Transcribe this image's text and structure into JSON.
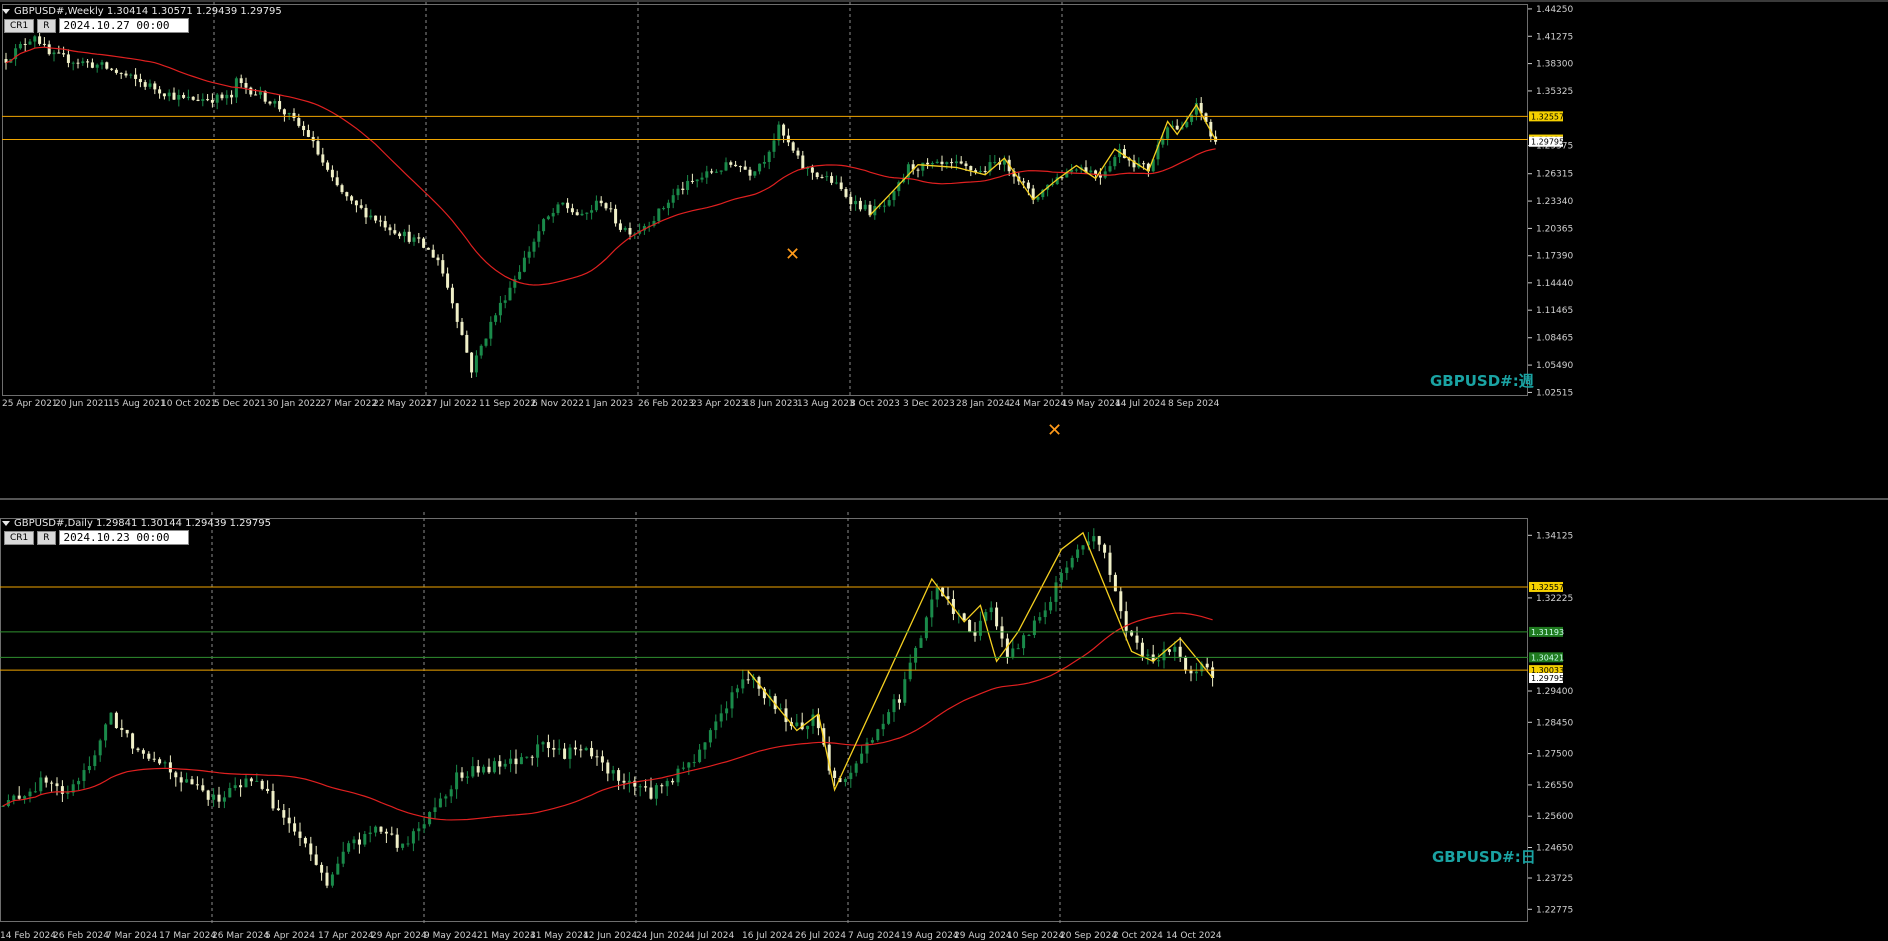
{
  "colors": {
    "background": "#000000",
    "bull": "#1a8a4a",
    "bear": "#f0f0c8",
    "ma": "#e02020",
    "zigzag": "#f5d020",
    "hline_gold": "#f0a500",
    "hline_green": "#2f8f2f",
    "label_teal": "#1aa3a3",
    "grid": "#8c8c8c",
    "axis_text": "#d0d0d0"
  },
  "weekly": {
    "header": "GBPUSD#,Weekly  1.30414 1.30571 1.29439 1.29795",
    "buttons": [
      "CR1",
      "R"
    ],
    "date_value": "2024.10.27 00:00",
    "symbol_label": "GBPUSD#:週",
    "cursor_icon": "crosshair-move-icon",
    "chart_data": {
      "type": "candlestick",
      "ylim": [
        1.0256,
        1.4435
      ],
      "price_ticks": [
        "1.44250",
        "1.41275",
        "1.38300",
        "1.35325",
        "1.29375",
        "1.26315",
        "1.23340",
        "1.20365",
        "1.17390",
        "1.14440",
        "1.11465",
        "1.08465",
        "1.05490",
        "1.02515"
      ],
      "time_ticks": [
        "25 Apr 2021",
        "20 Jun 2021",
        "15 Aug 2021",
        "10 Oct 2021",
        "5 Dec 2021",
        "30 Jan 2022",
        "27 Mar 2022",
        "22 May 2022",
        "17 Jul 2022",
        "11 Sep 2022",
        "6 Nov 2022",
        "1 Jan 2023",
        "26 Feb 2023",
        "23 Apr 2023",
        "18 Jun 2023",
        "13 Aug 2023",
        "8 Oct 2023",
        "3 Dec 2023",
        "28 Jan 2024",
        "24 Mar 2024",
        "19 May 2024",
        "14 Jul 2024",
        "8 Sep 2024"
      ],
      "hlines": [
        {
          "value": 1.32557,
          "label": "1.32557",
          "color": "gold"
        },
        {
          "value": 1.30033,
          "label": "1.30033",
          "color": "gold"
        }
      ],
      "close_label": "1.29795",
      "anchors": [
        [
          0,
          1.388
        ],
        [
          6,
          1.415
        ],
        [
          9,
          1.392
        ],
        [
          20,
          1.38
        ],
        [
          33,
          1.352
        ],
        [
          37,
          1.344
        ],
        [
          47,
          1.346
        ],
        [
          48,
          1.363
        ],
        [
          56,
          1.34
        ],
        [
          63,
          1.305
        ],
        [
          68,
          1.255
        ],
        [
          72,
          1.23
        ],
        [
          80,
          1.205
        ],
        [
          86,
          1.188
        ],
        [
          90,
          1.17
        ],
        [
          93,
          1.125
        ],
        [
          97,
          1.05
        ],
        [
          101,
          1.1
        ],
        [
          107,
          1.16
        ],
        [
          112,
          1.21
        ],
        [
          116,
          1.23
        ],
        [
          120,
          1.215
        ],
        [
          124,
          1.235
        ],
        [
          128,
          1.205
        ],
        [
          131,
          1.2
        ],
        [
          135,
          1.215
        ],
        [
          140,
          1.245
        ],
        [
          147,
          1.265
        ],
        [
          152,
          1.275
        ],
        [
          155,
          1.265
        ],
        [
          158,
          1.28
        ],
        [
          161,
          1.312
        ],
        [
          166,
          1.27
        ],
        [
          172,
          1.255
        ],
        [
          176,
          1.235
        ],
        [
          180,
          1.222
        ],
        [
          184,
          1.23
        ],
        [
          188,
          1.27
        ],
        [
          192,
          1.271
        ],
        [
          198,
          1.272
        ],
        [
          203,
          1.265
        ],
        [
          207,
          1.278
        ],
        [
          210,
          1.265
        ],
        [
          214,
          1.236
        ],
        [
          218,
          1.255
        ],
        [
          223,
          1.272
        ],
        [
          228,
          1.262
        ],
        [
          232,
          1.288
        ],
        [
          235,
          1.275
        ],
        [
          238,
          1.268
        ],
        [
          242,
          1.318
        ],
        [
          245,
          1.31
        ],
        [
          248,
          1.336
        ],
        [
          250,
          1.32
        ],
        [
          251,
          1.304
        ],
        [
          252,
          1.298
        ]
      ],
      "ma_period": 30,
      "zigzag": [
        [
          180,
          1.218
        ],
        [
          190,
          1.273
        ],
        [
          198,
          1.27
        ],
        [
          204,
          1.262
        ],
        [
          208,
          1.28
        ],
        [
          214,
          1.235
        ],
        [
          219,
          1.257
        ],
        [
          223,
          1.272
        ],
        [
          227,
          1.258
        ],
        [
          231,
          1.29
        ],
        [
          235,
          1.276
        ],
        [
          238,
          1.266
        ],
        [
          242,
          1.32
        ],
        [
          244,
          1.306
        ],
        [
          248,
          1.338
        ],
        [
          252,
          1.3
        ]
      ]
    }
  },
  "daily": {
    "header": "GBPUSD#,Daily  1.29841 1.30144 1.29439 1.29795",
    "buttons": [
      "CR1",
      "R"
    ],
    "date_value": "2024.10.23 00:00",
    "symbol_label": "GBPUSD#:日",
    "cursor_icon": "crosshair-move-icon",
    "chart_data": {
      "type": "candlestick",
      "ylim": [
        1.2245,
        1.3465
      ],
      "price_ticks": [
        "1.34125",
        "1.32225",
        "1.29400",
        "1.28450",
        "1.27500",
        "1.26550",
        "1.25600",
        "1.24650",
        "1.23725",
        "1.22775"
      ],
      "time_ticks": [
        "14 Feb 2024",
        "26 Feb 2024",
        "7 Mar 2024",
        "17 Mar 2024",
        "26 Mar 2024",
        "5 Apr 2024",
        "17 Apr 2024",
        "29 Apr 2024",
        "9 May 2024",
        "21 May 2024",
        "31 May 2024",
        "12 Jun 2024",
        "24 Jun 2024",
        "4 Jul 2024",
        "16 Jul 2024",
        "26 Jul 2024",
        "7 Aug 2024",
        "19 Aug 2024",
        "29 Aug 2024",
        "10 Sep 2024",
        "20 Sep 2024",
        "2 Oct 2024",
        "14 Oct 2024"
      ],
      "hlines": [
        {
          "value": 1.32557,
          "label": "1.32557",
          "color": "gold"
        },
        {
          "value": 1.31193,
          "label": "1.31193",
          "color": "green"
        },
        {
          "value": 1.30421,
          "label": "1.30421",
          "color": "green"
        },
        {
          "value": 1.30033,
          "label": "1.30033",
          "color": "gold"
        }
      ],
      "close_label": "1.29795",
      "anchors": [
        [
          0,
          1.259
        ],
        [
          8,
          1.267
        ],
        [
          12,
          1.262
        ],
        [
          16,
          1.272
        ],
        [
          20,
          1.286
        ],
        [
          24,
          1.278
        ],
        [
          30,
          1.272
        ],
        [
          34,
          1.266
        ],
        [
          40,
          1.261
        ],
        [
          46,
          1.268
        ],
        [
          50,
          1.26
        ],
        [
          55,
          1.249
        ],
        [
          60,
          1.236
        ],
        [
          64,
          1.247
        ],
        [
          70,
          1.252
        ],
        [
          74,
          1.246
        ],
        [
          78,
          1.255
        ],
        [
          84,
          1.268
        ],
        [
          88,
          1.27
        ],
        [
          94,
          1.272
        ],
        [
          100,
          1.277
        ],
        [
          104,
          1.275
        ],
        [
          108,
          1.276
        ],
        [
          112,
          1.27
        ],
        [
          116,
          1.266
        ],
        [
          120,
          1.263
        ],
        [
          124,
          1.268
        ],
        [
          128,
          1.273
        ],
        [
          132,
          1.285
        ],
        [
          136,
          1.295
        ],
        [
          138,
          1.298
        ],
        [
          142,
          1.292
        ],
        [
          146,
          1.282
        ],
        [
          150,
          1.286
        ],
        [
          154,
          1.266
        ],
        [
          158,
          1.272
        ],
        [
          162,
          1.283
        ],
        [
          166,
          1.292
        ],
        [
          170,
          1.31
        ],
        [
          173,
          1.326
        ],
        [
          177,
          1.316
        ],
        [
          180,
          1.312
        ],
        [
          183,
          1.32
        ],
        [
          186,
          1.303
        ],
        [
          190,
          1.312
        ],
        [
          194,
          1.322
        ],
        [
          198,
          1.336
        ],
        [
          201,
          1.341
        ],
        [
          204,
          1.336
        ],
        [
          206,
          1.324
        ],
        [
          208,
          1.311
        ],
        [
          211,
          1.306
        ],
        [
          214,
          1.303
        ],
        [
          217,
          1.309
        ],
        [
          220,
          1.298
        ],
        [
          222,
          1.302
        ],
        [
          224,
          1.298
        ]
      ],
      "ma_period": 50,
      "zigzag": [
        [
          138,
          1.3
        ],
        [
          147,
          1.282
        ],
        [
          151,
          1.287
        ],
        [
          154,
          1.264
        ],
        [
          172,
          1.328
        ],
        [
          178,
          1.315
        ],
        [
          181,
          1.32
        ],
        [
          184,
          1.303
        ],
        [
          188,
          1.312
        ],
        [
          196,
          1.337
        ],
        [
          200,
          1.342
        ],
        [
          209,
          1.306
        ],
        [
          213,
          1.303
        ],
        [
          218,
          1.31
        ],
        [
          224,
          1.298
        ]
      ]
    }
  }
}
